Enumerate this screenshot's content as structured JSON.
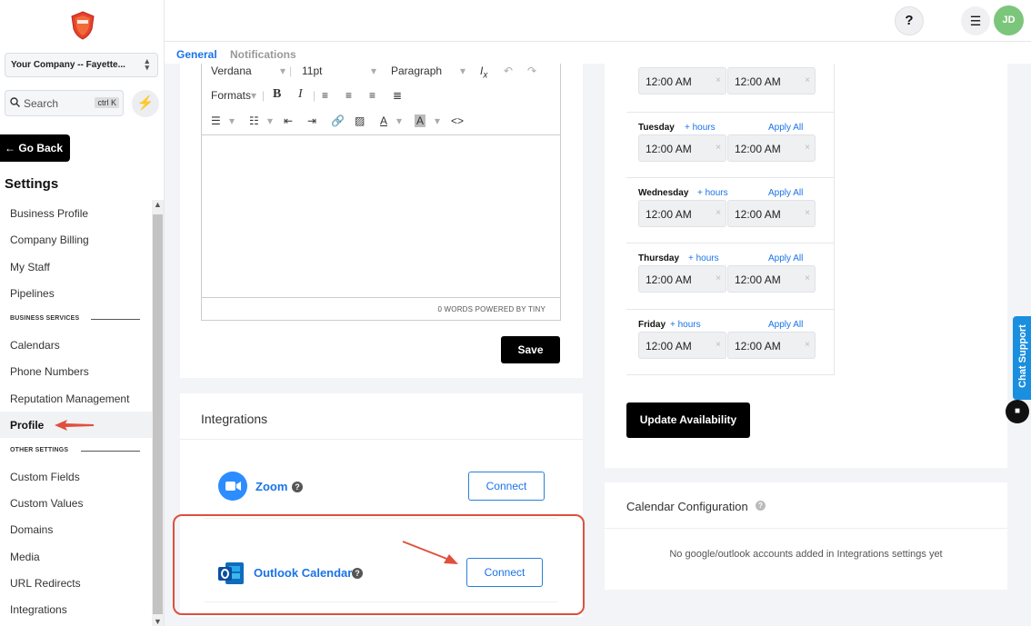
{
  "sidebar": {
    "company": "Your Company -- Fayette...",
    "search_placeholder": "Search",
    "search_shortcut": "ctrl K",
    "go_back": "Go Back",
    "settings_title": "Settings",
    "items": [
      {
        "label": "Business Profile"
      },
      {
        "label": "Company Billing"
      },
      {
        "label": "My Staff"
      },
      {
        "label": "Pipelines"
      },
      {
        "label": "Calendars"
      },
      {
        "label": "Phone Numbers"
      },
      {
        "label": "Reputation Management"
      },
      {
        "label": "Profile"
      },
      {
        "label": "Custom Fields"
      },
      {
        "label": "Custom Values"
      },
      {
        "label": "Domains"
      },
      {
        "label": "Media"
      },
      {
        "label": "URL Redirects"
      },
      {
        "label": "Integrations"
      }
    ],
    "section_business": "BUSINESS SERVICES",
    "section_other": "OTHER SETTINGS"
  },
  "topbar": {
    "help": "?",
    "avatar_initials": "JD"
  },
  "tabs": {
    "general": "General",
    "notifications": "Notifications"
  },
  "editor": {
    "font": "Verdana",
    "size": "11pt",
    "block": "Paragraph",
    "formats": "Formats",
    "status": "0 WORDS POWERED BY TINY",
    "save": "Save"
  },
  "integrations": {
    "title": "Integrations",
    "zoom": {
      "name": "Zoom",
      "button": "Connect"
    },
    "outlook": {
      "name": "Outlook Calendar",
      "button": "Connect"
    }
  },
  "availability": {
    "top_row": {
      "start": "12:00 AM",
      "end": "12:00 AM"
    },
    "days": [
      {
        "name": "Tuesday",
        "add": "+ hours",
        "apply": "Apply All",
        "start": "12:00 AM",
        "end": "12:00 AM"
      },
      {
        "name": "Wednesday",
        "add": "+ hours",
        "apply": "Apply All",
        "start": "12:00 AM",
        "end": "12:00 AM"
      },
      {
        "name": "Thursday",
        "add": "+ hours",
        "apply": "Apply All",
        "start": "12:00 AM",
        "end": "12:00 AM"
      },
      {
        "name": "Friday",
        "add": "+ hours",
        "apply": "Apply All",
        "start": "12:00 AM",
        "end": "12:00 AM"
      }
    ],
    "update_button": "Update Availability"
  },
  "calendar_config": {
    "title": "Calendar Configuration",
    "empty": "No google/outlook accounts added in Integrations settings yet"
  },
  "chat_support": "Chat Support",
  "colors": {
    "accent": "#1a73e8",
    "highlight": "#dd5040",
    "avatar": "#7bc67a"
  }
}
